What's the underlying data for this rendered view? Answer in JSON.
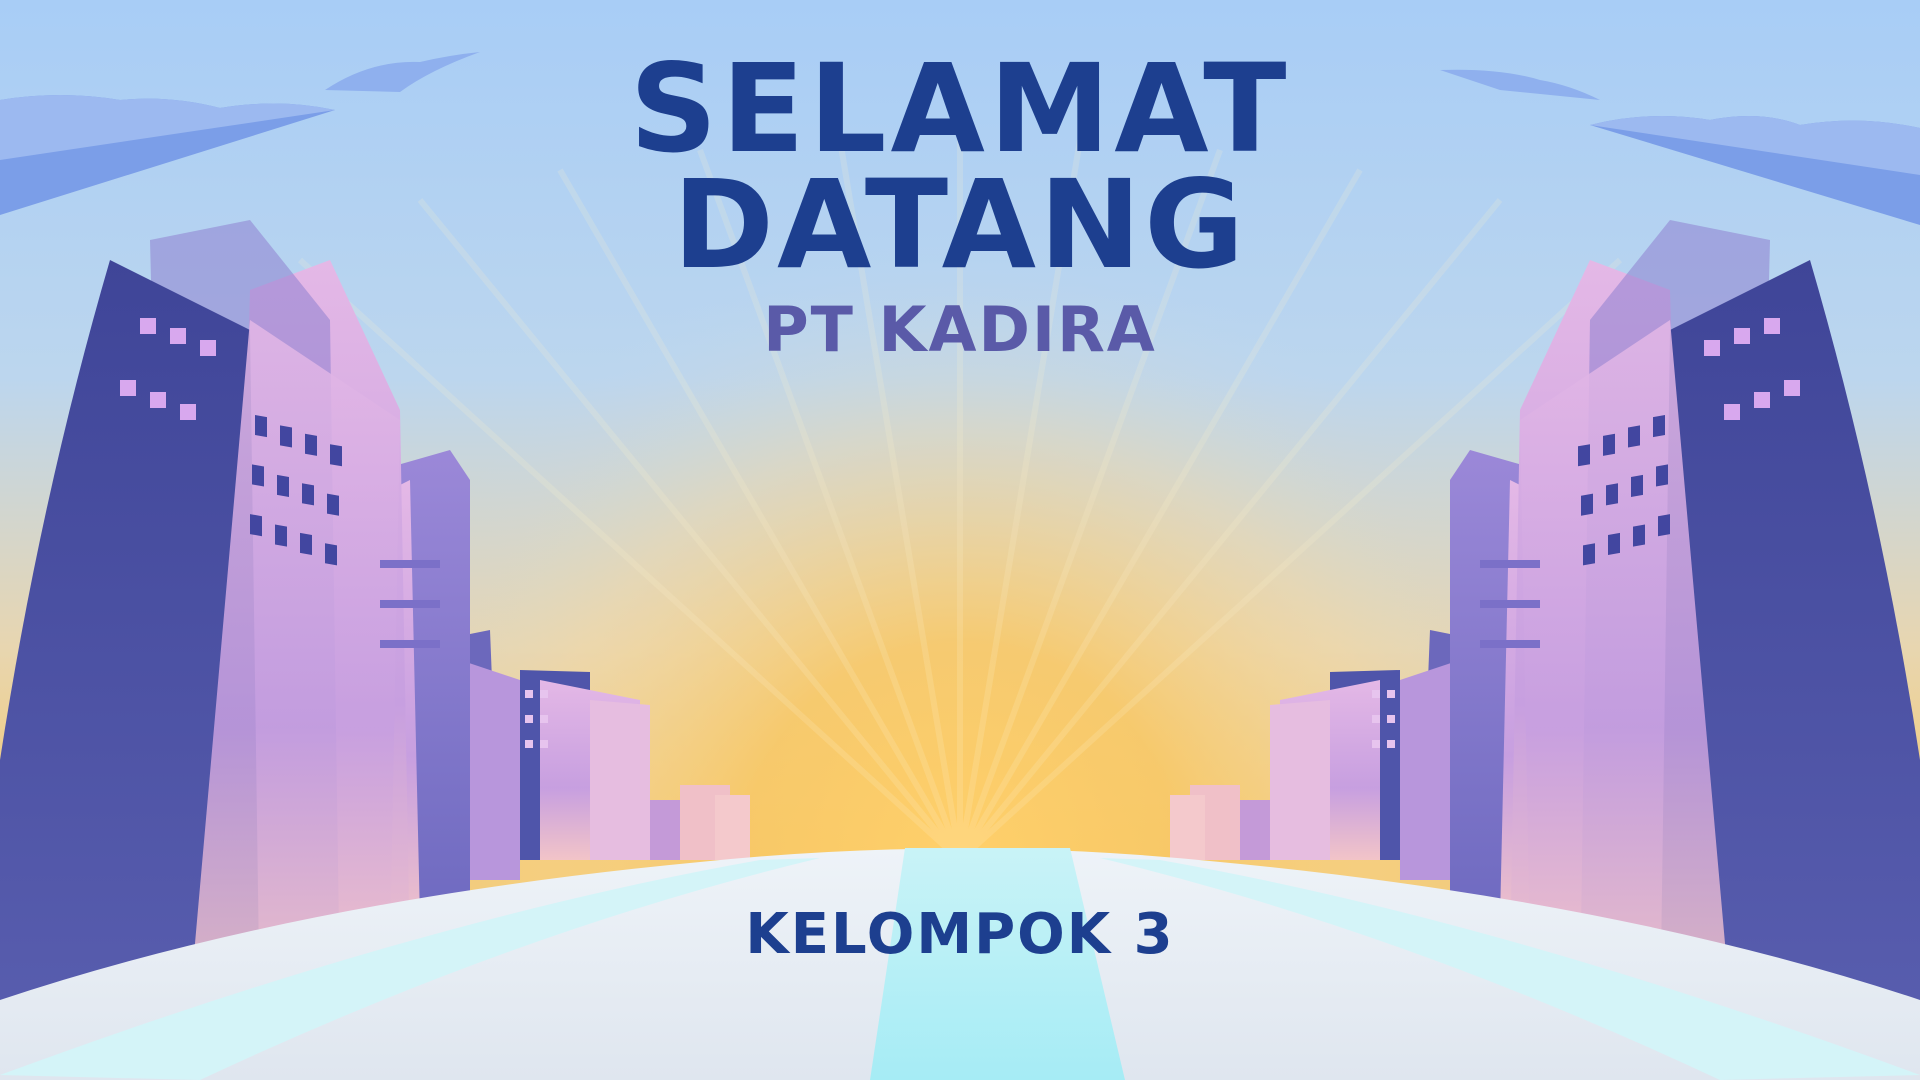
{
  "slide": {
    "title_line1": "SELAMAT",
    "title_line2": "DATANG",
    "subtitle": "PT KADIRA",
    "group_label": "KELOMPOK 3"
  },
  "colors": {
    "sky_top": "#a9cdf5",
    "sun_glow": "#f6c25a",
    "title_color": "#1d3f8f",
    "subtitle_color": "#5a5aa8",
    "building_dark": "#4a4ea0",
    "building_light": "#c8a0e0",
    "road_light": "#d8f3f8"
  }
}
